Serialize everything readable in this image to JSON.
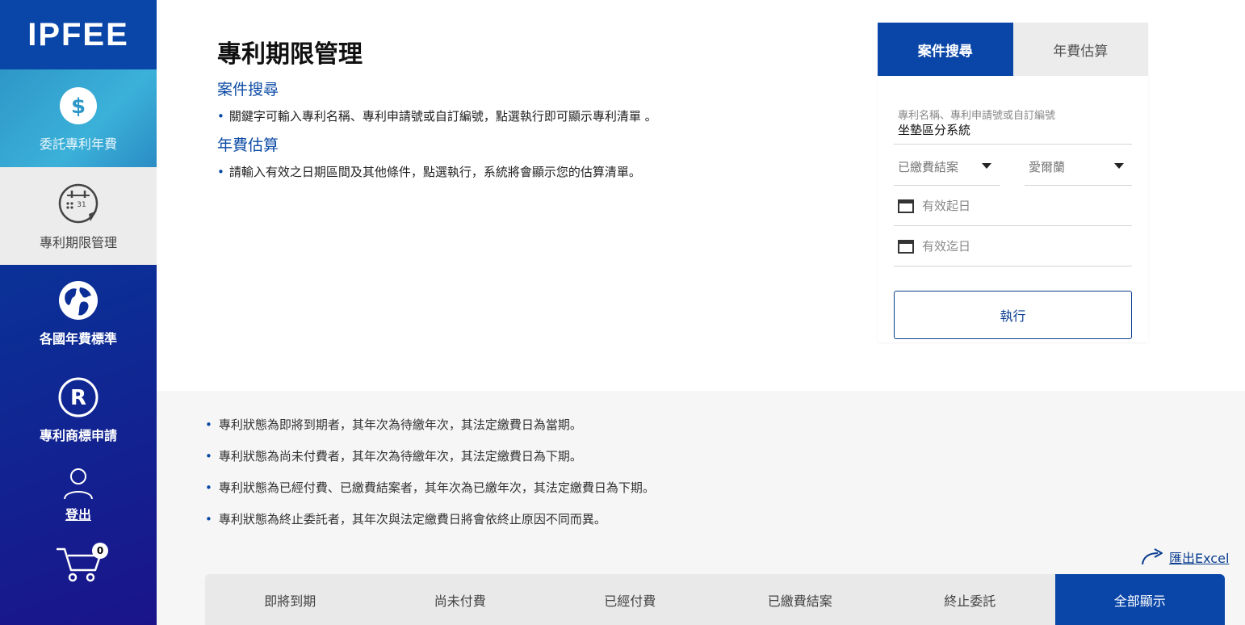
{
  "sidebar": {
    "logo": "IPFEE",
    "items": [
      {
        "label": "委託專利年費"
      },
      {
        "label": "專利期限管理"
      },
      {
        "label": "各國年費標準"
      },
      {
        "label": "專利商標申請"
      },
      {
        "label": "登出"
      }
    ],
    "cart_count": "0",
    "calendar_day": "31"
  },
  "header": {
    "title": "專利期限管理",
    "sections": [
      {
        "heading": "案件搜尋",
        "text": "關鍵字可輸入專利名稱、專利申請號或自訂編號，點選執行即可顯示專利清單 。"
      },
      {
        "heading": "年費估算",
        "text": "請輸入有效之日期區間及其他條件，點選執行，系統將會顯示您的估算清單。"
      }
    ]
  },
  "panel": {
    "tabs": [
      {
        "label": "案件搜尋",
        "active": true
      },
      {
        "label": "年費估算",
        "active": false
      }
    ],
    "keyword_label": "專利名稱、專利申請號或自訂編號",
    "keyword_value": "坐墊區分系統",
    "status_select": "已繳費結案",
    "country_select": "愛爾蘭",
    "start_date_placeholder": "有效起日",
    "end_date_placeholder": "有效迄日",
    "run_button": "執行"
  },
  "notes": [
    "專利狀態為即將到期者，其年次為待繳年次，其法定繳費日為當期。",
    "專利狀態為尚未付費者，其年次為待繳年次，其法定繳費日為下期。",
    "專利狀態為已經付費、已繳費結案者，其年次為已繳年次，其法定繳費日為下期。",
    "專利狀態為終止委託者，其年次與法定繳費日將會依終止原因不同而異。"
  ],
  "export_label": "匯出Excel",
  "status_tabs": [
    {
      "label": "即將到期"
    },
    {
      "label": "尚未付費"
    },
    {
      "label": "已經付費"
    },
    {
      "label": "已繳費結案"
    },
    {
      "label": "終止委託"
    },
    {
      "label": "全部顯示"
    }
  ],
  "colors": {
    "brand_blue": "#0a46a8",
    "accent_cyan": "#3bb1d9"
  }
}
